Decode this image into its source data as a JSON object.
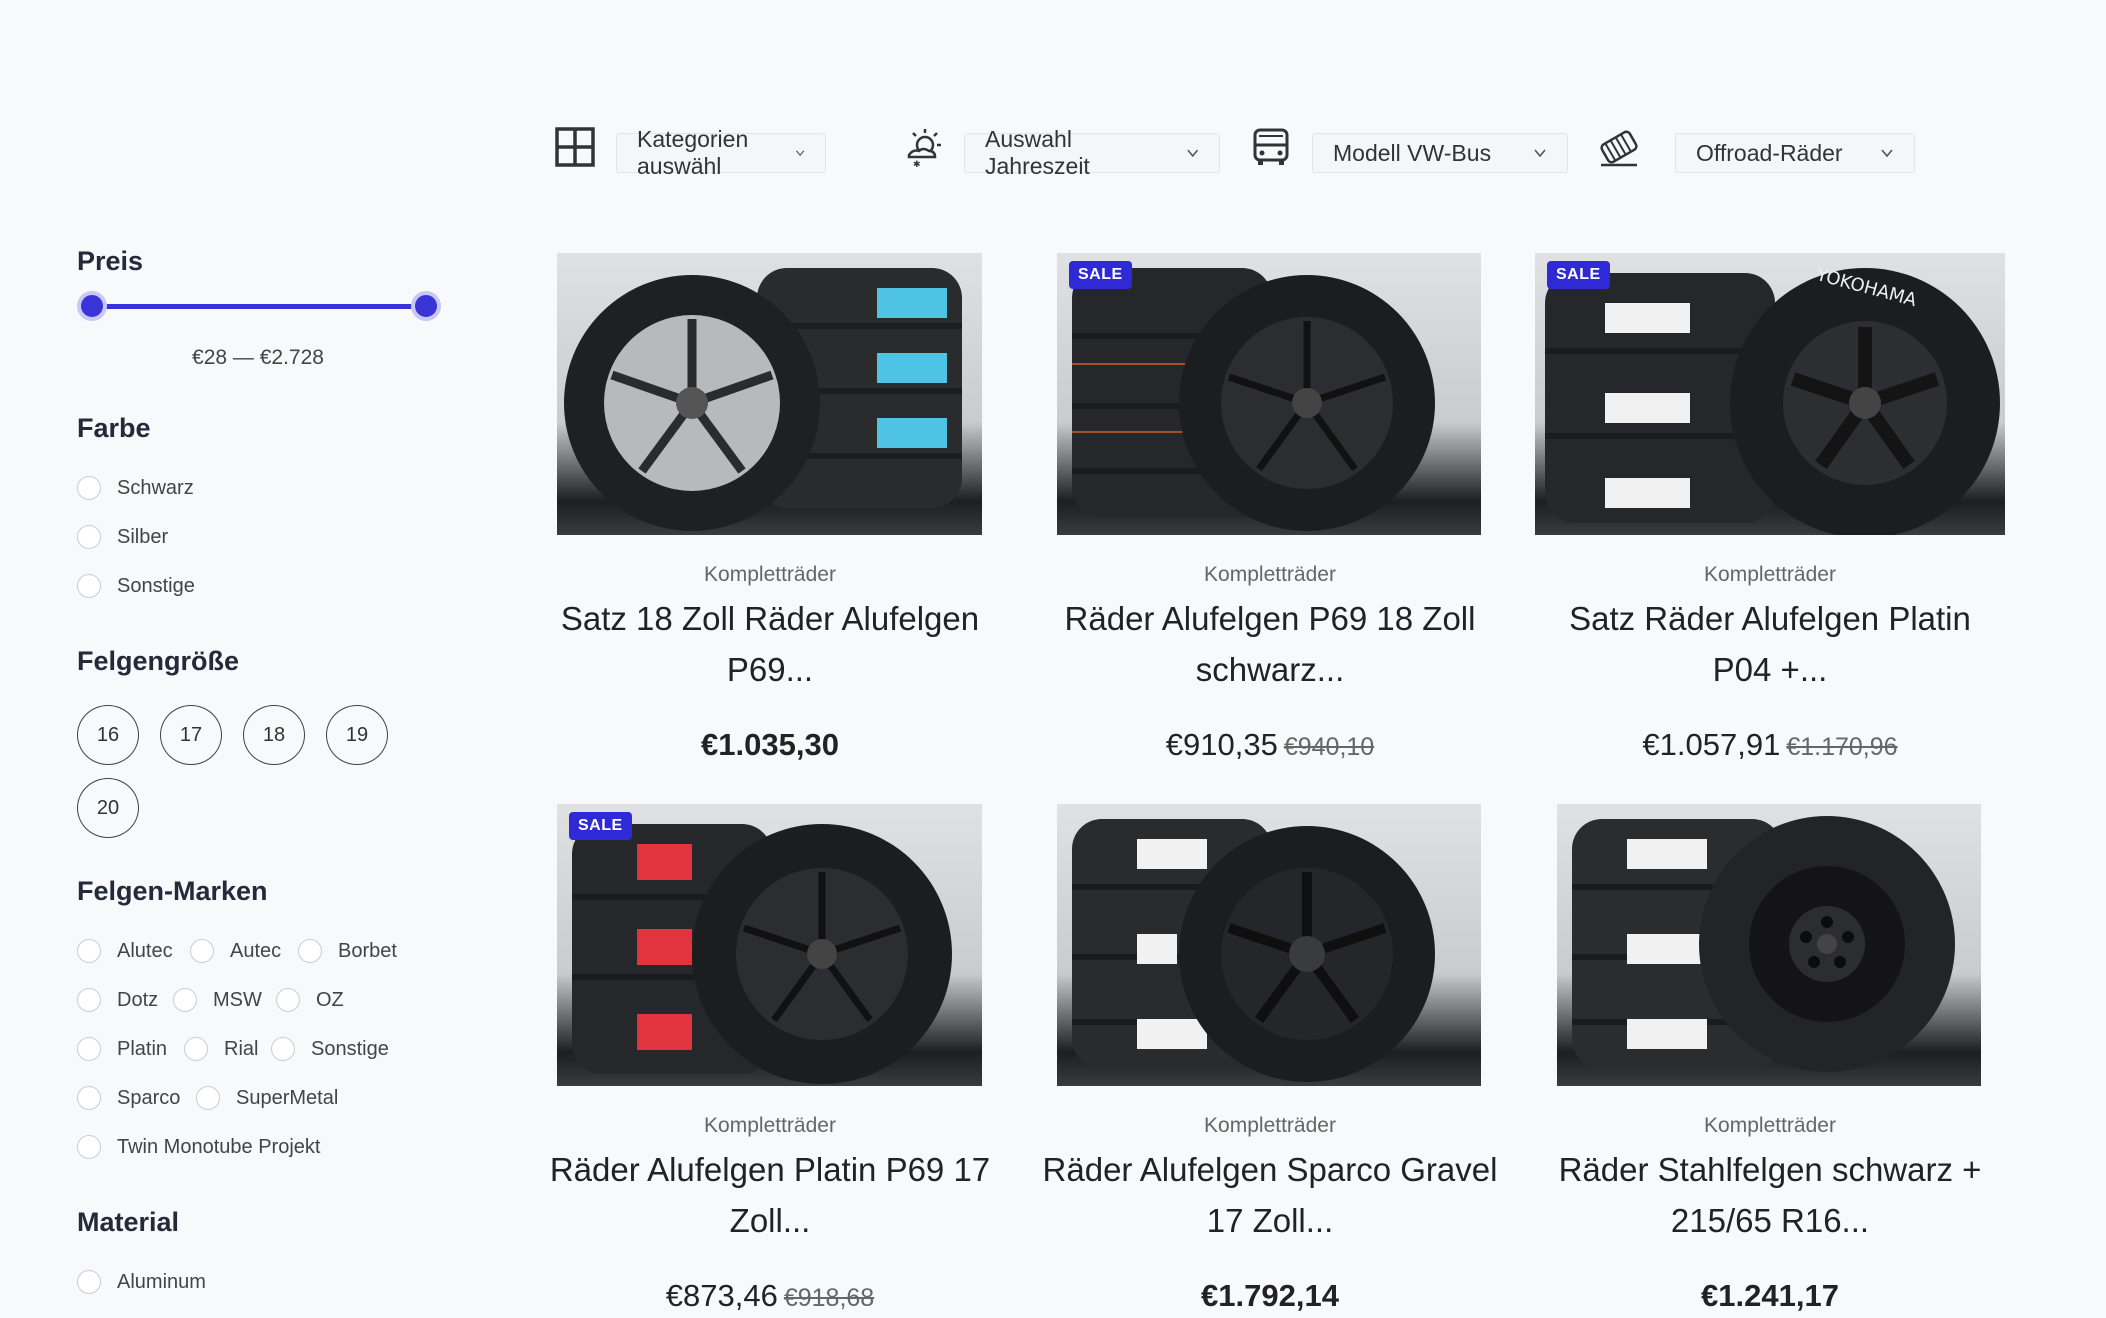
{
  "filters": {
    "category_label": "Kategorien auswähl",
    "season_label": "Auswahl Jahreszeit",
    "model_label": "Modell VW-Bus",
    "type_label": "Offroad-Räder"
  },
  "sidebar": {
    "price": {
      "heading": "Preis",
      "range_label": "€28 — €2.728",
      "min": 28,
      "max": 2728,
      "low_position": 0,
      "high_position": 1
    },
    "color": {
      "heading": "Farbe",
      "options": [
        "Schwarz",
        "Silber",
        "Sonstige"
      ]
    },
    "rim_size": {
      "heading": "Felgengröße",
      "options": [
        "16",
        "17",
        "18",
        "19",
        "20"
      ]
    },
    "brands": {
      "heading": "Felgen-Marken",
      "options": [
        "Alutec",
        "Autec",
        "Borbet",
        "Dotz",
        "MSW",
        "OZ",
        "Platin",
        "Rial",
        "Sonstige",
        "Sparco",
        "SuperMetal",
        "Twin Monotube Projekt"
      ]
    },
    "material": {
      "heading": "Material",
      "options": [
        "Aluminum"
      ]
    }
  },
  "products": [
    {
      "category": "Kompletträder",
      "title_line1": "Satz 18 Zoll Räder Alufelgen",
      "title_line2": "P69...",
      "price": "€1.035,30",
      "old_price": "",
      "sale": false,
      "sale_label": ""
    },
    {
      "category": "Kompletträder",
      "title_line1": "Räder Alufelgen P69 18 Zoll",
      "title_line2": "schwarz...",
      "price": "€910,35",
      "old_price": "€940,10",
      "sale": true,
      "sale_label": "SALE"
    },
    {
      "category": "Kompletträder",
      "title_line1": "Satz Räder Alufelgen Platin",
      "title_line2": "P04 +...",
      "price": "€1.057,91",
      "old_price": "€1.170,96",
      "sale": true,
      "sale_label": "SALE"
    },
    {
      "category": "Kompletträder",
      "title_line1": "Räder Alufelgen Platin P69 17",
      "title_line2": "Zoll...",
      "price": "€873,46",
      "old_price": "€918,68",
      "sale": true,
      "sale_label": "SALE"
    },
    {
      "category": "Kompletträder",
      "title_line1": "Räder Alufelgen Sparco Gravel",
      "title_line2": "17 Zoll...",
      "price": "€1.792,14",
      "old_price": "",
      "sale": false,
      "sale_label": ""
    },
    {
      "category": "Kompletträder",
      "title_line1": "Räder Stahlfelgen schwarz +",
      "title_line2": "215/65 R16...",
      "price": "€1.241,17",
      "old_price": "",
      "sale": false,
      "sale_label": ""
    }
  ],
  "icons": {
    "category": "grid-icon",
    "season": "sun-snow-icon",
    "model": "bus-icon",
    "type": "offroad-tire-icon",
    "dropdown": "chevron-down-icon"
  },
  "colors": {
    "accent": "#3a34d8",
    "sale_badge": "#2f2ad6",
    "background": "#f8f9fb"
  }
}
